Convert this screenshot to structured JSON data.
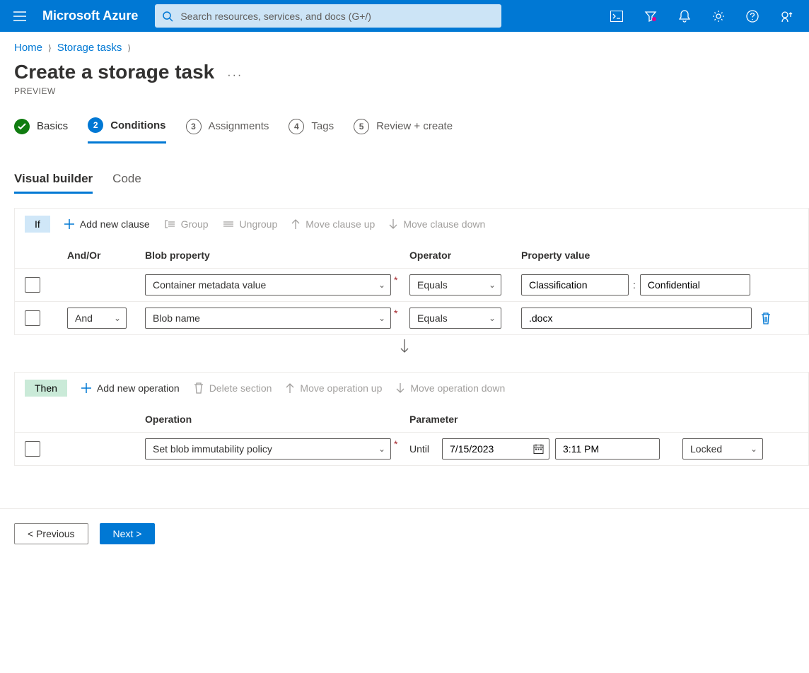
{
  "brand": "Microsoft Azure",
  "search": {
    "placeholder": "Search resources, services, and docs (G+/)"
  },
  "breadcrumb": [
    "Home",
    "Storage tasks"
  ],
  "page": {
    "title": "Create a storage task",
    "subtitle": "PREVIEW"
  },
  "steps": [
    {
      "label": "Basics",
      "state": "done"
    },
    {
      "label": "Conditions",
      "state": "active",
      "num": "2"
    },
    {
      "label": "Assignments",
      "state": "pending",
      "num": "3"
    },
    {
      "label": "Tags",
      "state": "pending",
      "num": "4"
    },
    {
      "label": "Review + create",
      "state": "pending",
      "num": "5"
    }
  ],
  "subtabs": [
    {
      "label": "Visual builder",
      "active": true
    },
    {
      "label": "Code",
      "active": false
    }
  ],
  "ifSection": {
    "pill": "If",
    "actions": {
      "add": "Add new clause",
      "group": "Group",
      "ungroup": "Ungroup",
      "moveUp": "Move clause up",
      "moveDown": "Move clause down"
    },
    "headers": {
      "andor": "And/Or",
      "prop": "Blob property",
      "op": "Operator",
      "val": "Property value"
    },
    "rows": [
      {
        "andor": "",
        "property": "Container metadata value",
        "operator": "Equals",
        "valueKey": "Classification",
        "valueVal": "Confidential",
        "kv": true
      },
      {
        "andor": "And",
        "property": "Blob name",
        "operator": "Equals",
        "value": ".docx",
        "kv": false
      }
    ]
  },
  "thenSection": {
    "pill": "Then",
    "actions": {
      "add": "Add new operation",
      "delete": "Delete section",
      "moveUp": "Move operation up",
      "moveDown": "Move operation down"
    },
    "headers": {
      "op": "Operation",
      "param": "Parameter"
    },
    "rows": [
      {
        "operation": "Set blob immutability policy",
        "untilLabel": "Until",
        "date": "7/15/2023",
        "time": "3:11 PM",
        "mode": "Locked"
      }
    ]
  },
  "footer": {
    "prev": "< Previous",
    "next": "Next >"
  }
}
